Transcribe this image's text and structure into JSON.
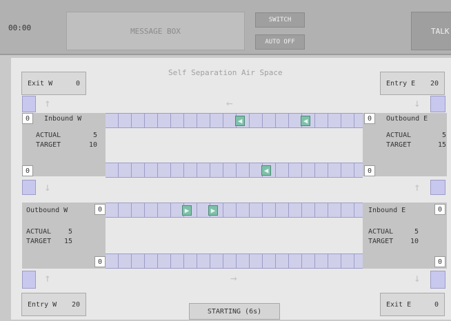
{
  "topbar": {
    "timer": "00:00",
    "message_box": "MESSAGE BOX",
    "switch_label": "SWITCH",
    "auto_label": "AUTO OFF",
    "talk_label": "TALK"
  },
  "airspace": {
    "title": "Self Separation Air Space"
  },
  "exit_w": {
    "label": "Exit W",
    "value": "0"
  },
  "entry_e": {
    "label": "Entry E",
    "value": "20"
  },
  "entry_w": {
    "label": "Entry W",
    "value": "20"
  },
  "exit_e": {
    "label": "Exit E",
    "value": "0"
  },
  "inbound_w": {
    "label": "Inbound W",
    "top_count": "0",
    "bottom_count": "0",
    "actual_label": "ACTUAL",
    "actual": "5",
    "target_label": "TARGET",
    "target": "10"
  },
  "outbound_e": {
    "label": "Outbound E",
    "top_count": "0",
    "bottom_count": "0",
    "actual_label": "ACTUAL",
    "actual": "5",
    "target_label": "TARGET",
    "target": "15"
  },
  "outbound_w": {
    "label": "Outbound W",
    "top_count": "0",
    "bottom_count": "0",
    "actual_label": "ACTUAL",
    "actual": "5",
    "target_label": "TARGET",
    "target": "15"
  },
  "inbound_e": {
    "label": "Inbound E",
    "top_count": "0",
    "bottom_count": "0",
    "actual_label": "ACTUAL",
    "actual": "5",
    "target_label": "TARGET",
    "target": "10"
  },
  "status_button": "STARTING (6s)",
  "aircraft": {
    "west_left_glyph": "◀",
    "east_right_glyph": "▶"
  },
  "arrows": {
    "up": "↑",
    "down": "↓",
    "left": "←",
    "right": "→"
  },
  "colors": {
    "lane": "#cfcfea",
    "aircraft": "#7fc0aa",
    "panel": "#c4c4c4"
  }
}
